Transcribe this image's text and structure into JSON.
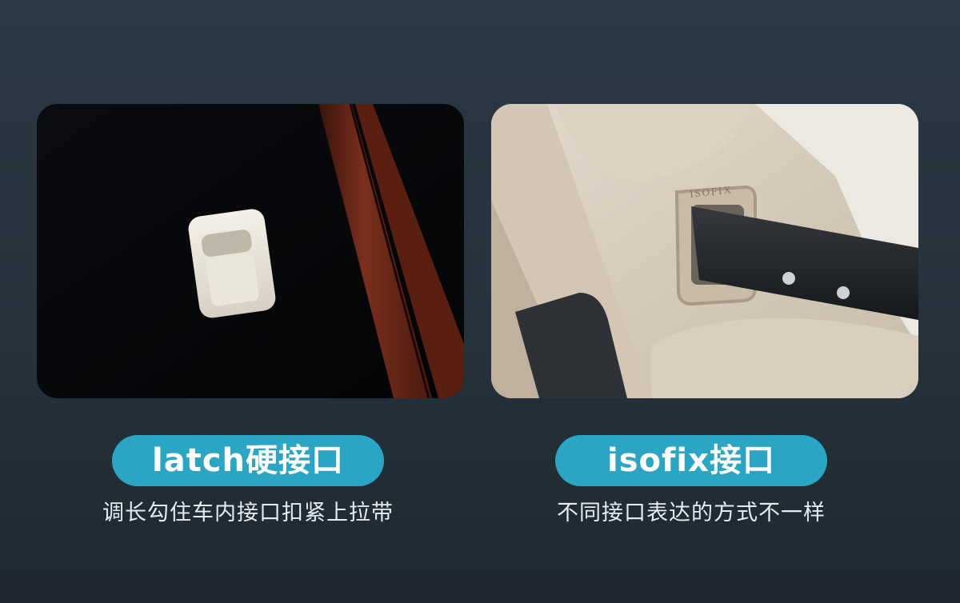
{
  "left_card": {
    "label": "latch硬接口",
    "caption": "调长勾住车内接口扣紧上拉带",
    "image": "latch-anchor-photo"
  },
  "right_card": {
    "label": "isofix接口",
    "caption": "不同接口表达的方式不一样",
    "image": "isofix-anchor-photo",
    "embossed_text": "ISOFIX"
  },
  "colors": {
    "background": "#26323c",
    "pill": "#2aa6c4",
    "caption_text": "#e6ebee"
  }
}
